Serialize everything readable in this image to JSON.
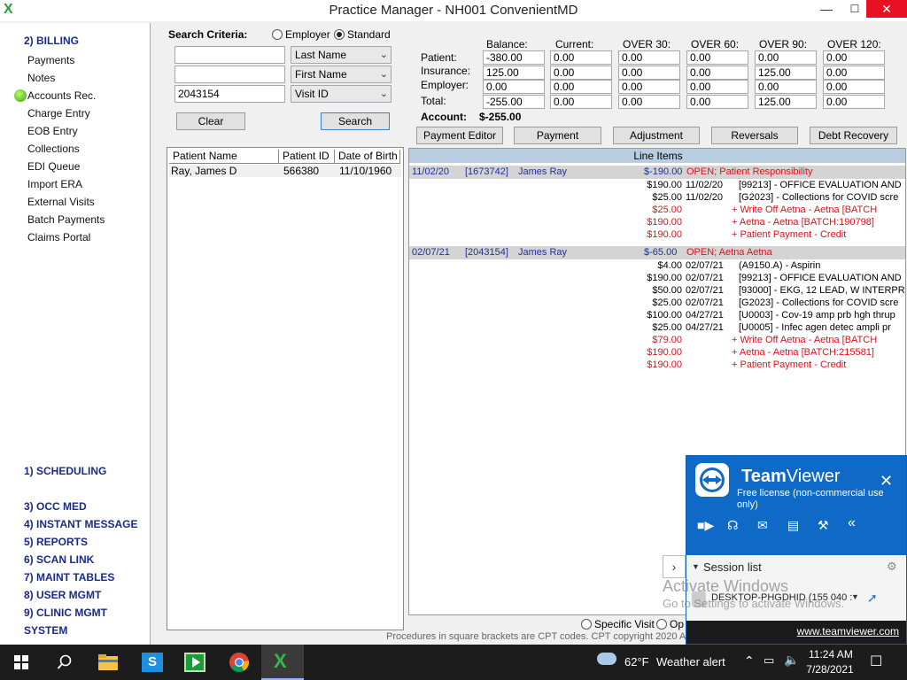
{
  "window": {
    "title": "Practice Manager - NH001 ConvenientMD",
    "min": "—",
    "max": "☐",
    "close": "✕"
  },
  "app_logo": "X",
  "nav": {
    "section": "2) BILLING",
    "items": [
      "Payments",
      "Notes",
      "Accounts Rec.",
      "Charge Entry",
      "EOB Entry",
      "Collections",
      "EDI Queue",
      "Import ERA",
      "External Visits",
      "Batch Payments",
      "Claims Portal"
    ],
    "bottom": [
      "1) SCHEDULING",
      "3) OCC MED",
      "4) INSTANT MESSAGE",
      "5) REPORTS",
      "6) SCAN LINK",
      "7) MAINT TABLES",
      "8) USER MGMT",
      "9) CLINIC MGMT",
      "SYSTEM"
    ]
  },
  "search": {
    "label": "Search Criteria:",
    "radio_employer": "Employer",
    "radio_standard": "Standard",
    "selected": "Standard",
    "field1_value": "",
    "field2_value": "",
    "field3_value": "2043154",
    "select1": "Last Name",
    "select2": "First Name",
    "select3": "Visit ID",
    "clear": "Clear",
    "search": "Search"
  },
  "patient_table": {
    "columns": [
      "Patient Name",
      "Patient ID",
      "Date of Birth"
    ],
    "rows": [
      {
        "name": "Ray, James D",
        "id": "566380",
        "dob": "11/10/1960"
      }
    ]
  },
  "balances": {
    "columns": [
      "Balance:",
      "Current:",
      "OVER 30:",
      "OVER 60:",
      "OVER 90:",
      "OVER 120:"
    ],
    "rows": [
      {
        "label": "Patient:",
        "values": [
          "-380.00",
          "0.00",
          "0.00",
          "0.00",
          "0.00",
          "0.00"
        ]
      },
      {
        "label": "Insurance:",
        "values": [
          "125.00",
          "0.00",
          "0.00",
          "0.00",
          "125.00",
          "0.00"
        ]
      },
      {
        "label": "Employer:",
        "values": [
          "0.00",
          "0.00",
          "0.00",
          "0.00",
          "0.00",
          "0.00"
        ]
      },
      {
        "label": "Total:",
        "values": [
          "-255.00",
          "0.00",
          "0.00",
          "0.00",
          "125.00",
          "0.00"
        ]
      }
    ],
    "account_label": "Account:",
    "account_value": "$-255.00"
  },
  "actions": [
    "Payment Editor",
    "Payment",
    "Adjustment",
    "Reversals",
    "Debt Recovery"
  ],
  "line_items": {
    "header": "Line Items",
    "groups": [
      {
        "date": "11/02/20",
        "visit": "[1673742]",
        "patient": "James Ray",
        "amount": "$-190.00",
        "status": "OPEN;  Patient Responsibility",
        "lines": [
          {
            "amount": "$190.00",
            "date": "11/02/20",
            "desc": "[99213] - OFFICE EVALUATION AND",
            "red": false
          },
          {
            "amount": "$25.00",
            "date": "11/02/20",
            "desc": "[G2023] - Collections for COVID scre",
            "red": false
          },
          {
            "amount": "$25.00",
            "date": "",
            "desc": "+ Write Off  Aetna - Aetna   [BATCH",
            "red": true
          },
          {
            "amount": "$190.00",
            "date": "",
            "desc": "+ Aetna - Aetna   [BATCH:190798]",
            "red": true
          },
          {
            "amount": "$190.00",
            "date": "",
            "desc": "+ Patient Payment - Credit",
            "red": true
          }
        ]
      },
      {
        "date": "02/07/21",
        "visit": "[2043154]",
        "patient": "James Ray",
        "amount": "$-65.00",
        "status": "OPEN;  Aetna Aetna",
        "lines": [
          {
            "amount": "$4.00",
            "date": "02/07/21",
            "desc": "(A9150.A) - Aspirin",
            "red": false
          },
          {
            "amount": "$190.00",
            "date": "02/07/21",
            "desc": "[99213] - OFFICE EVALUATION AND",
            "red": false
          },
          {
            "amount": "$50.00",
            "date": "02/07/21",
            "desc": "[93000] - EKG, 12 LEAD, W INTERPR I",
            "red": false
          },
          {
            "amount": "$25.00",
            "date": "02/07/21",
            "desc": "[G2023] - Collections for COVID scre",
            "red": false
          },
          {
            "amount": "$100.00",
            "date": "04/27/21",
            "desc": "[U0003] - Cov-19 amp prb hgh thrup",
            "red": false
          },
          {
            "amount": "$25.00",
            "date": "04/27/21",
            "desc": "[U0005] - Infec agen detec ampli pr",
            "red": false
          },
          {
            "amount": "$79.00",
            "date": "",
            "desc": "+ Write Off  Aetna - Aetna   [BATCH",
            "red": true
          },
          {
            "amount": "$190.00",
            "date": "",
            "desc": "+ Aetna - Aetna   [BATCH:215581]",
            "red": true
          },
          {
            "amount": "$190.00",
            "date": "",
            "desc": "+ Patient Payment - Credit",
            "red": true
          }
        ]
      }
    ]
  },
  "bottom_radios": {
    "specific_visit": "Specific Visit",
    "other": "Op"
  },
  "footer_note": "Procedures in square brackets are CPT codes. CPT copyright 2020 A",
  "teamviewer": {
    "brand_bold": "Team",
    "brand_light": "Viewer",
    "license": "Free license (non-commercial use only)",
    "close": "✕",
    "session_label": "Session list",
    "device": "DESKTOP-PHGDHID (155 040 :",
    "url": "www.teamviewer.com"
  },
  "activate": {
    "title": "Activate Windows",
    "sub": "Go to Settings to activate Windows."
  },
  "taskbar": {
    "weather_temp": "62°F",
    "weather_text": "Weather alert",
    "time": "11:24 AM",
    "date": "7/28/2021"
  }
}
